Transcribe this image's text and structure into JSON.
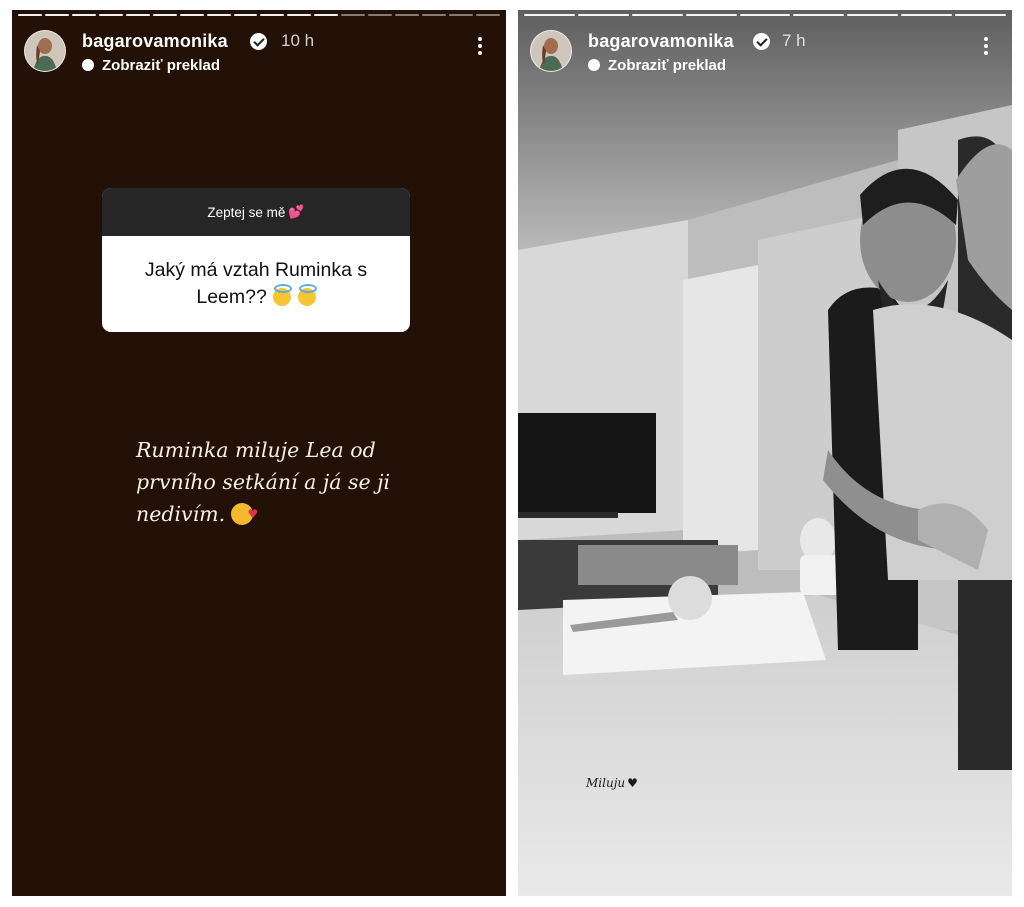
{
  "stories": [
    {
      "username": "bagarovamonika",
      "time": "10 h",
      "translate_label": "Zobraziť preklad",
      "question_title": "Zeptej se mě",
      "question_text": "Jaký má vztah Ruminka s Leem??",
      "answer_text": "Ruminka miluje Lea od prvního setkání a já se ji nedivím."
    },
    {
      "username": "bagarovamonika",
      "time": "7 h",
      "translate_label": "Zobraziť preklad",
      "caption": "Miluju"
    }
  ],
  "colors": {
    "left_background": "#231006",
    "question_header": "#262626"
  }
}
